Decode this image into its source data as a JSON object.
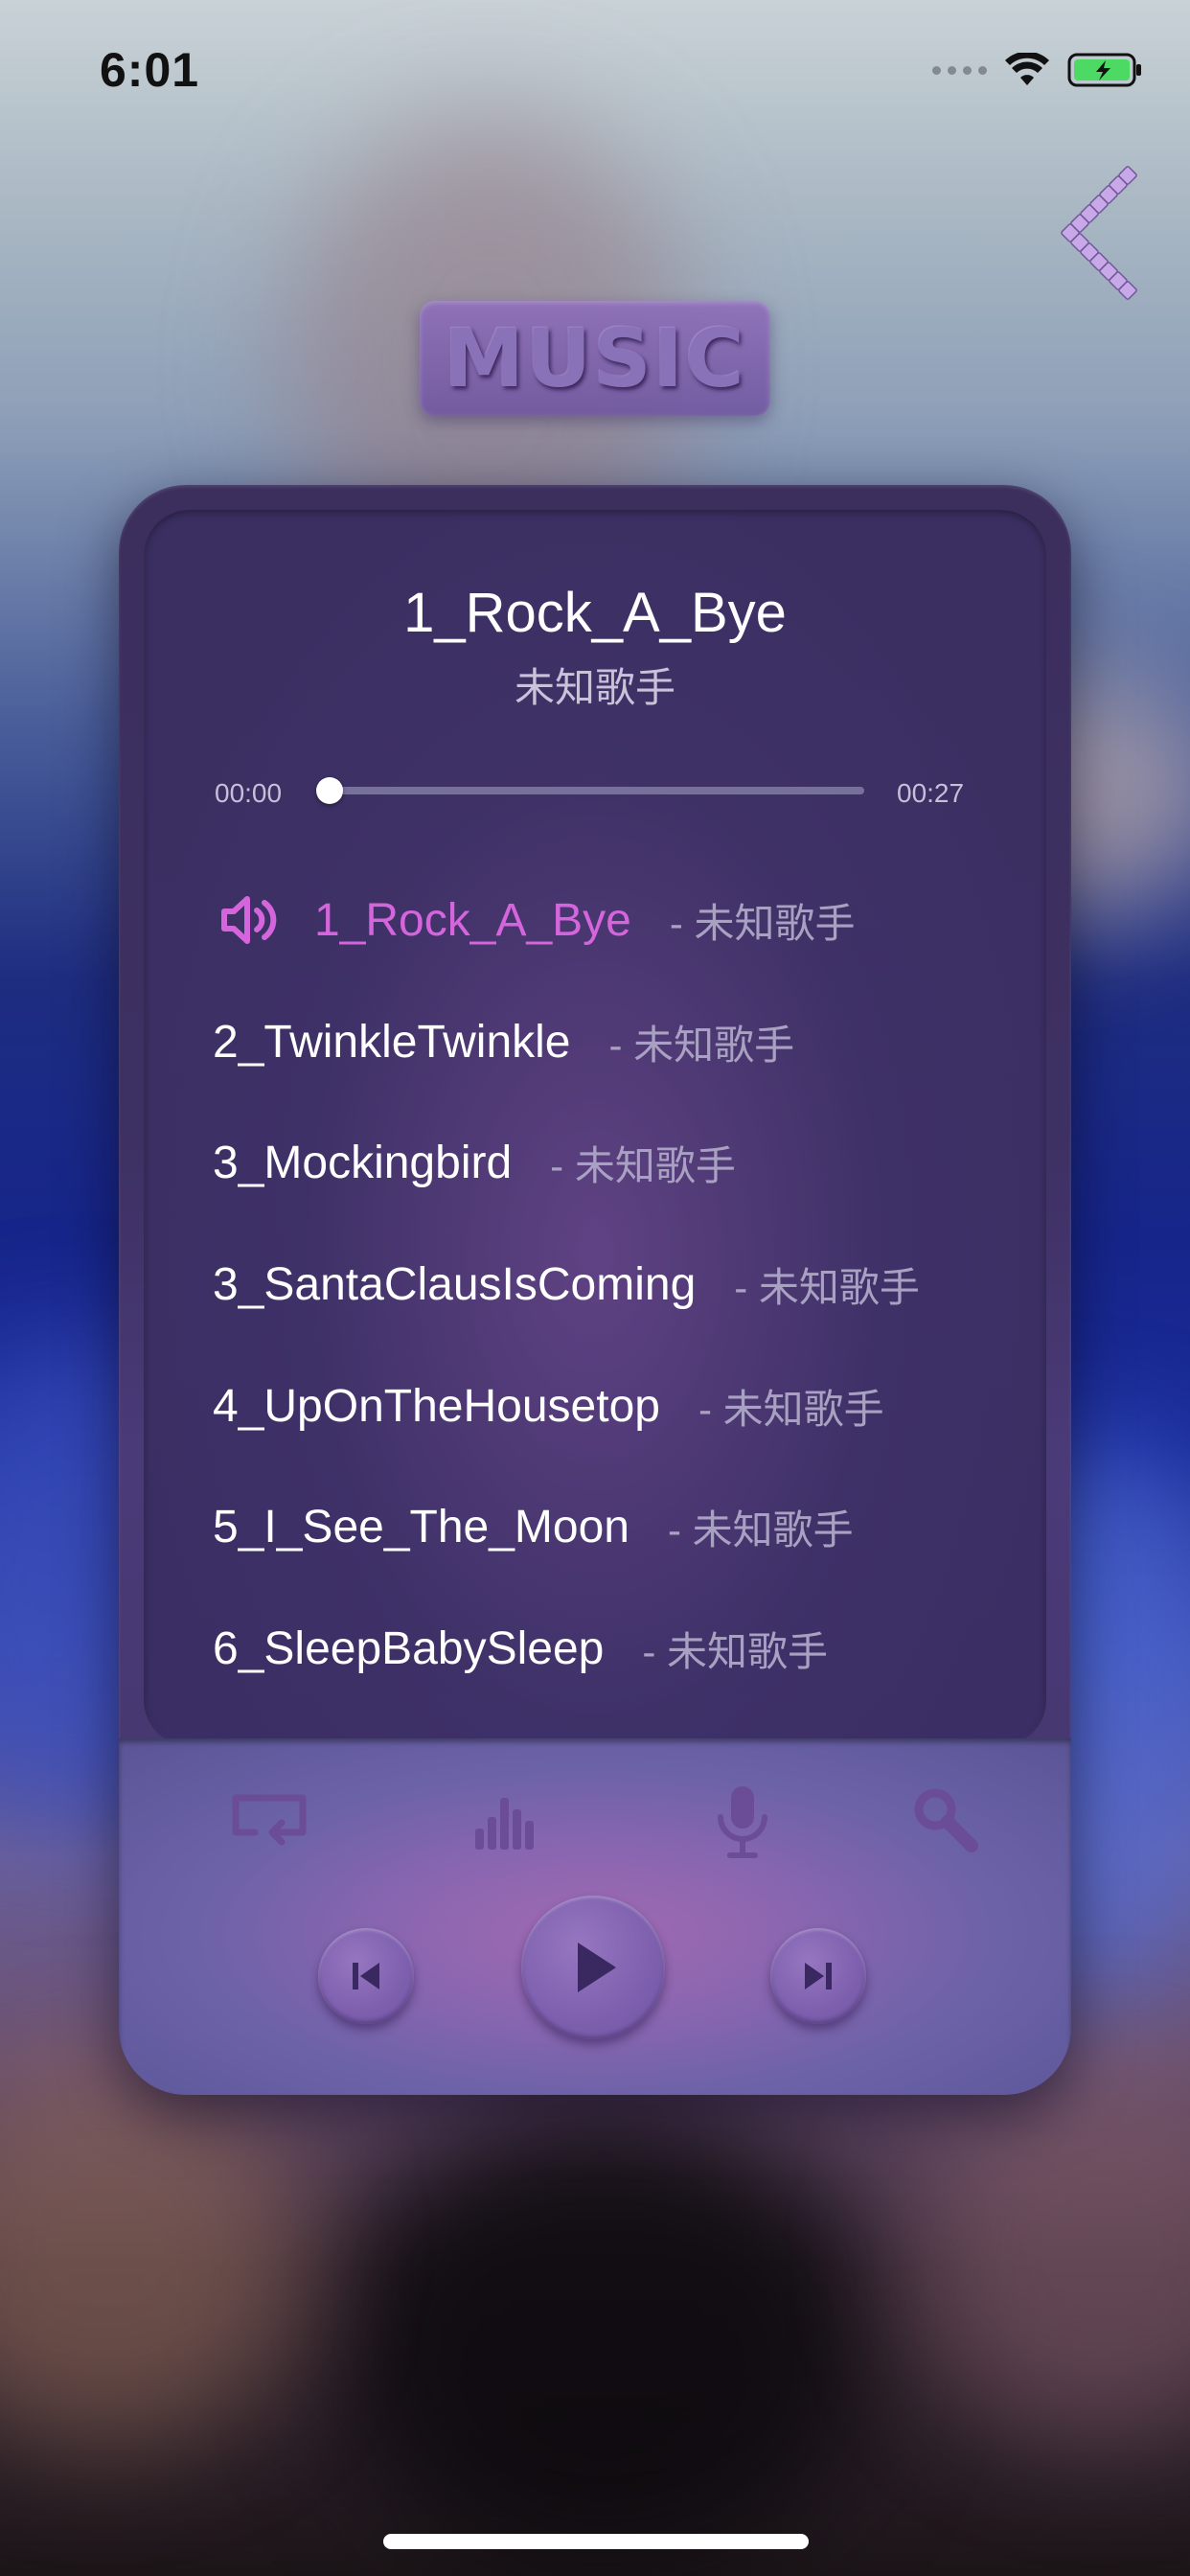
{
  "status_bar": {
    "time": "6:01",
    "signal_icon": "cellular-dots-icon",
    "wifi_icon": "wifi-icon",
    "battery_icon": "battery-charging-icon",
    "battery_color": "#4cd964"
  },
  "header": {
    "badge_label": "MUSIC",
    "back_icon": "chevron-left-icon"
  },
  "now_playing": {
    "title": "1_Rock_A_Bye",
    "artist": "未知歌手",
    "elapsed": "00:00",
    "duration": "00:27",
    "progress": 0.0
  },
  "playlist": [
    {
      "name": "1_Rock_A_Bye",
      "artist": "- 未知歌手",
      "playing": true
    },
    {
      "name": "2_TwinkleTwinkle",
      "artist": "- 未知歌手",
      "playing": false
    },
    {
      "name": "3_Mockingbird",
      "artist": "- 未知歌手",
      "playing": false
    },
    {
      "name": "3_SantaClausIsComing",
      "artist": "- 未知歌手",
      "playing": false
    },
    {
      "name": "4_UpOnTheHousetop",
      "artist": "- 未知歌手",
      "playing": false
    },
    {
      "name": "5_I_See_The_Moon",
      "artist": "- 未知歌手",
      "playing": false
    },
    {
      "name": "6_SleepBabySleep",
      "artist": "- 未知歌手",
      "playing": false
    }
  ],
  "toolbar": {
    "repeat_icon": "repeat-icon",
    "equalizer_icon": "equalizer-icon",
    "microphone_icon": "microphone-icon",
    "search_icon": "search-icon"
  },
  "transport": {
    "previous_icon": "skip-previous-icon",
    "play_icon": "play-icon",
    "next_icon": "skip-next-icon"
  },
  "colors": {
    "accent": "#d565dc",
    "card": "#3c2f5e",
    "panel": "#8a66b0"
  }
}
